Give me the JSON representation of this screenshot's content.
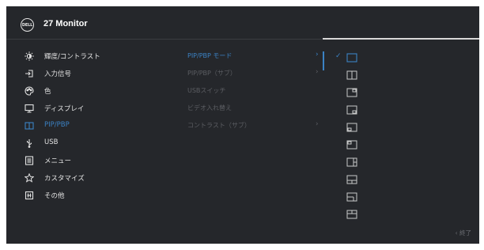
{
  "header": {
    "logo_text": "DELL",
    "title": "27 Monitor"
  },
  "menu": {
    "items": [
      {
        "label": "輝度/コントラスト",
        "icon": "brightness-icon",
        "active": false
      },
      {
        "label": "入力信号",
        "icon": "input-source-icon",
        "active": false
      },
      {
        "label": "色",
        "icon": "color-palette-icon",
        "active": false
      },
      {
        "label": "ディスプレイ",
        "icon": "display-icon",
        "active": false
      },
      {
        "label": "PIP/PBP",
        "icon": "pip-pbp-icon",
        "active": true
      },
      {
        "label": "USB",
        "icon": "usb-icon",
        "active": false
      },
      {
        "label": "メニュー",
        "icon": "menu-icon",
        "active": false
      },
      {
        "label": "カスタマイズ",
        "icon": "star-icon",
        "active": false
      },
      {
        "label": "その他",
        "icon": "others-icon",
        "active": false
      }
    ]
  },
  "submenu": {
    "items": [
      {
        "label": "PIP/PBP モード",
        "arrow": "›",
        "active": true
      },
      {
        "label": "PIP/PBP（サブ）",
        "arrow": "›",
        "active": false
      },
      {
        "label": "USBスイッチ",
        "arrow": "",
        "active": false
      },
      {
        "label": "ビデオ入れ替え",
        "arrow": "",
        "active": false
      },
      {
        "label": "コントラスト（サブ）",
        "arrow": "›",
        "active": false
      }
    ]
  },
  "layout_options": {
    "selected_index": 0,
    "check_mark": "✓",
    "items": [
      "layout-off-icon",
      "layout-pbp-split-icon",
      "layout-pip-top-right-icon",
      "layout-pip-bottom-right-icon",
      "layout-pip-bottom-left-icon",
      "layout-pip-top-left-icon",
      "layout-pbp-large-left-icon",
      "layout-pbp-bottom-icon",
      "layout-pbp-right-icon",
      "layout-pbp-top-icon"
    ]
  },
  "footer": {
    "back_label": "‹ 終了"
  },
  "colors": {
    "accent": "#3b82c4",
    "panel": "#25272b",
    "text": "#e2e2e2",
    "dim_text": "#5b5d62"
  }
}
